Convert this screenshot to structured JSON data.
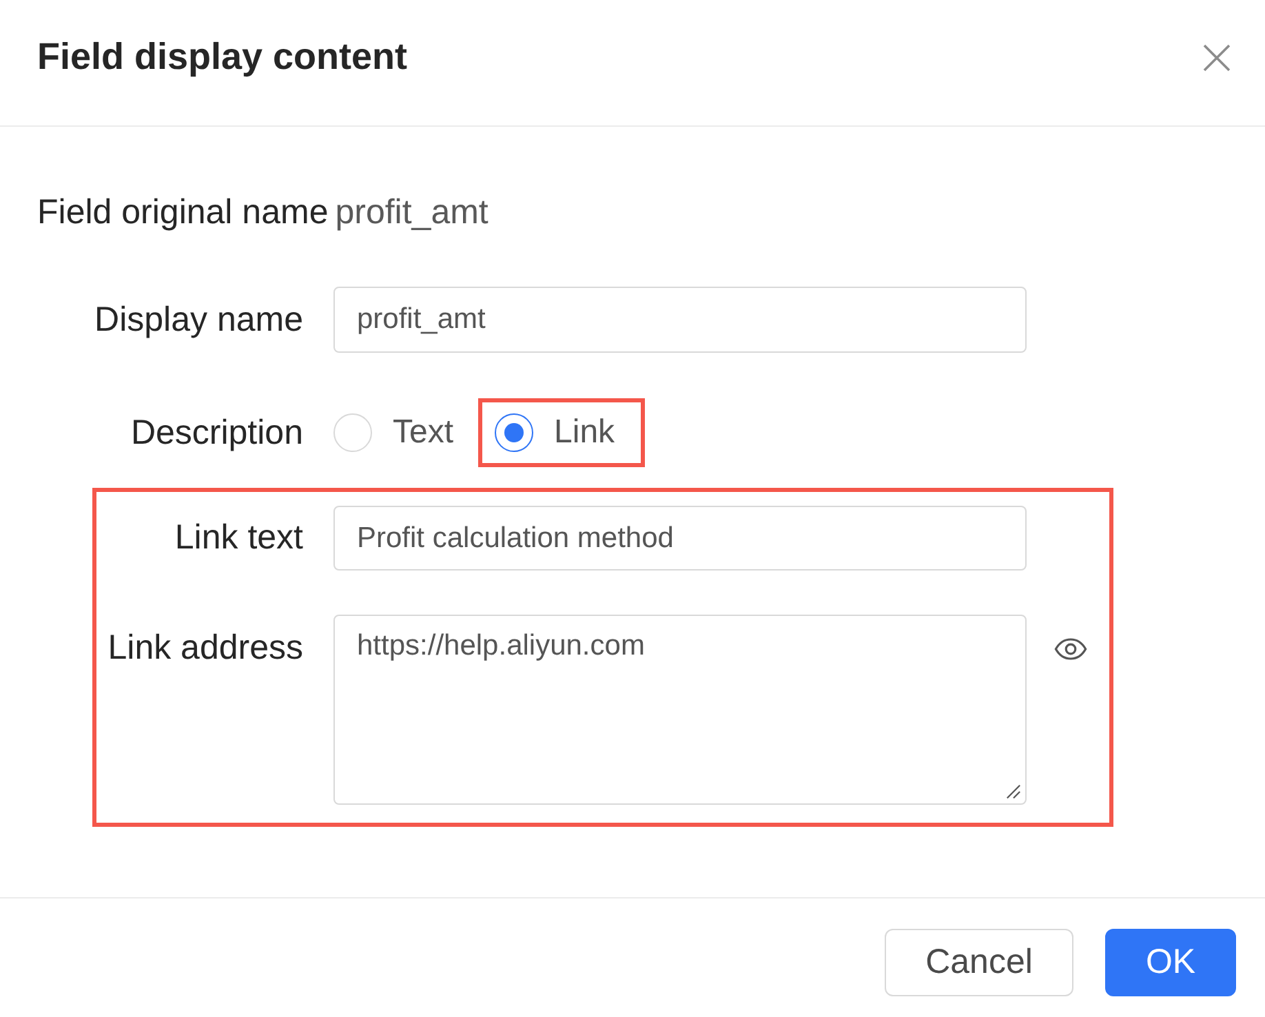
{
  "dialog": {
    "title": "Field display content"
  },
  "original_name": {
    "label": "Field original name",
    "value": "profit_amt"
  },
  "display_name": {
    "label": "Display name",
    "value": "profit_amt"
  },
  "description": {
    "label": "Description",
    "options": [
      {
        "label": "Text",
        "selected": false,
        "highlighted": false
      },
      {
        "label": "Link",
        "selected": true,
        "highlighted": true
      }
    ]
  },
  "link_settings": {
    "highlighted": true,
    "fields": [
      {
        "kind": "input",
        "label": "Link text",
        "value": "Profit calculation method"
      },
      {
        "kind": "textarea",
        "label": "Link address",
        "value": "https://help.aliyun.com"
      }
    ]
  },
  "buttons": [
    {
      "label": "Cancel",
      "kind": "secondary"
    },
    {
      "label": "OK",
      "kind": "primary"
    }
  ]
}
